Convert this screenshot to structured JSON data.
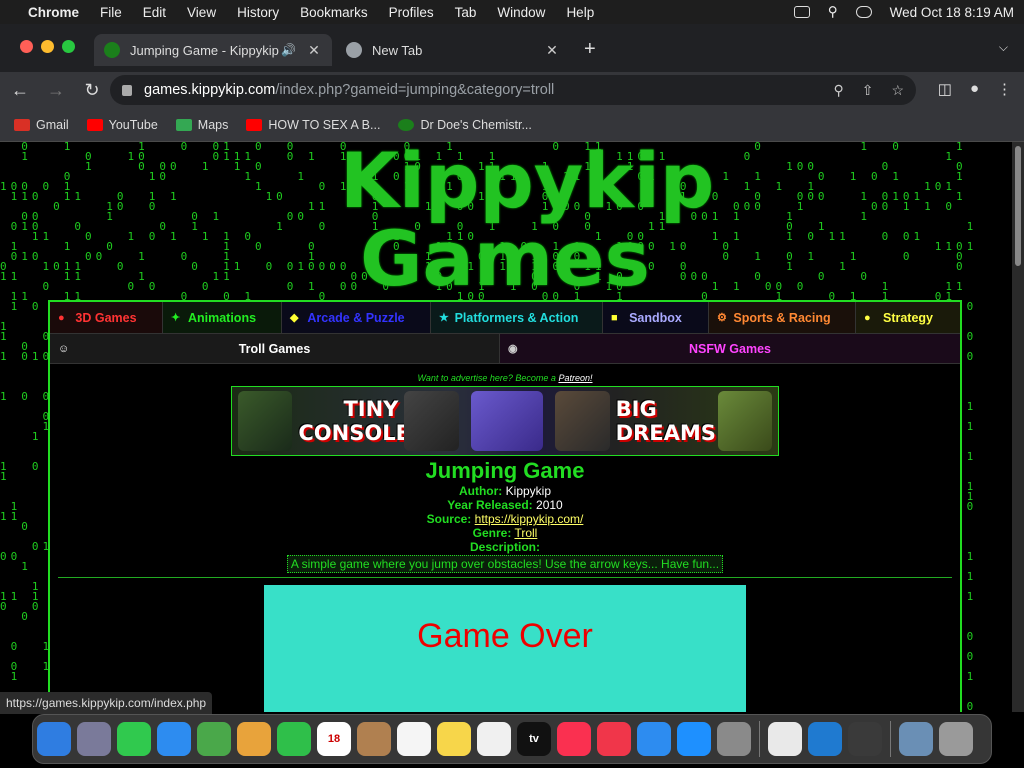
{
  "menubar": {
    "app": "Chrome",
    "items": [
      "File",
      "Edit",
      "View",
      "History",
      "Bookmarks",
      "Profiles",
      "Tab",
      "Window",
      "Help"
    ],
    "datetime": "Wed Oct 18  8:19 AM"
  },
  "tabs": [
    {
      "title": "Jumping Game - Kippykip",
      "active": true
    },
    {
      "title": "New Tab",
      "active": false
    }
  ],
  "address": {
    "host": "games.kippykip.com",
    "path": "/index.php?gameid=jumping&category=troll"
  },
  "bookmarks": [
    {
      "label": "Gmail",
      "icon": "gmail-icon",
      "color": "#d93025"
    },
    {
      "label": "YouTube",
      "icon": "youtube-icon",
      "color": "#ff0000"
    },
    {
      "label": "Maps",
      "icon": "maps-icon",
      "color": "#34a853"
    },
    {
      "label": "HOW TO SEX A B...",
      "icon": "youtube-icon",
      "color": "#ff0000"
    },
    {
      "label": "Dr Doe's Chemistr...",
      "icon": "site-icon",
      "color": "#1b7f1b"
    }
  ],
  "site": {
    "logo_line1": "Kippykip",
    "logo_line2": "Games",
    "categories": [
      {
        "label": "3D Games",
        "color": "#ff3333",
        "bg": "#1a0a0a",
        "icon": "3d-icon"
      },
      {
        "label": "Animations",
        "color": "#22ee22",
        "bg": "#0a1a0a",
        "icon": "animation-icon"
      },
      {
        "label": "Arcade & Puzzle",
        "color": "#3333ff",
        "bg": "#0a0a1a",
        "icon": "arcade-icon"
      },
      {
        "label": "Platformers & Action",
        "color": "#22dddd",
        "bg": "#0a1a1a",
        "icon": "platformer-icon"
      },
      {
        "label": "Sandbox",
        "color": "#aaaaff",
        "bg": "#0a0a1a",
        "icon": "sandbox-icon"
      },
      {
        "label": "Sports & Racing",
        "color": "#ff8833",
        "bg": "#1a100a",
        "icon": "sports-icon"
      },
      {
        "label": "Strategy",
        "color": "#ffff44",
        "bg": "#1a1a0a",
        "icon": "strategy-icon"
      }
    ],
    "categories2": [
      {
        "label": "Troll Games",
        "color": "#ffffff",
        "bg": "#1a1a1a",
        "icon": "troll-icon"
      },
      {
        "label": "NSFW Games",
        "color": "#ff44ff",
        "bg": "#1a0a1a",
        "icon": "nsfw-icon"
      }
    ],
    "ad_text": "Want to advertise here? Become a",
    "ad_link": "Patreon!",
    "banner": {
      "left": "TINY CONSOLE",
      "right": "BIG DREAMS"
    },
    "game": {
      "title": "Jumping Game",
      "author_label": "Author:",
      "author": "Kippykip",
      "year_label": "Year Released:",
      "year": "2010",
      "source_label": "Source:",
      "source": "https://kippykip.com/",
      "genre_label": "Genre:",
      "genre": "Troll",
      "desc_label": "Description:",
      "description": "A simple game where you jump over obstacles! Use the arrow keys... Have fun...",
      "screen_text": "Game Over"
    }
  },
  "status_url": "https://games.kippykip.com/index.php",
  "dock": [
    {
      "icon": "finder-icon",
      "color": "#2f7de1",
      "label": ""
    },
    {
      "icon": "launchpad-icon",
      "color": "#7a7a9a",
      "label": ""
    },
    {
      "icon": "messages-icon",
      "color": "#30c94e",
      "label": ""
    },
    {
      "icon": "mail-icon",
      "color": "#2d8cf0",
      "label": ""
    },
    {
      "icon": "maps-icon",
      "color": "#4aa84a",
      "label": ""
    },
    {
      "icon": "photos-icon",
      "color": "#e8a33b",
      "label": ""
    },
    {
      "icon": "facetime-icon",
      "color": "#2fbf4a",
      "label": ""
    },
    {
      "icon": "calendar-icon",
      "color": "#ffffff",
      "label": "18"
    },
    {
      "icon": "contacts-icon",
      "color": "#b08050",
      "label": ""
    },
    {
      "icon": "reminders-icon",
      "color": "#f5f5f5",
      "label": ""
    },
    {
      "icon": "notes-icon",
      "color": "#f7d64a",
      "label": ""
    },
    {
      "icon": "freeform-icon",
      "color": "#f0f0f0",
      "label": ""
    },
    {
      "icon": "tv-icon",
      "color": "#111111",
      "label": "tv"
    },
    {
      "icon": "music-icon",
      "color": "#fa3050",
      "label": ""
    },
    {
      "icon": "news-icon",
      "color": "#f0364a",
      "label": ""
    },
    {
      "icon": "keynote-icon",
      "color": "#2d8cf0",
      "label": ""
    },
    {
      "icon": "appstore-icon",
      "color": "#1e90ff",
      "label": ""
    },
    {
      "icon": "settings-icon",
      "color": "#8a8a8a",
      "label": ""
    },
    {
      "icon": "chrome-icon",
      "color": "#e9e9e9",
      "label": ""
    },
    {
      "icon": "vscode-icon",
      "color": "#1f7ad0",
      "label": ""
    },
    {
      "icon": "quicktime-icon",
      "color": "#3a3a3a",
      "label": ""
    },
    {
      "icon": "downloads-icon",
      "color": "#6a8fb5",
      "label": ""
    },
    {
      "icon": "trash-icon",
      "color": "#9a9a9a",
      "label": ""
    }
  ]
}
